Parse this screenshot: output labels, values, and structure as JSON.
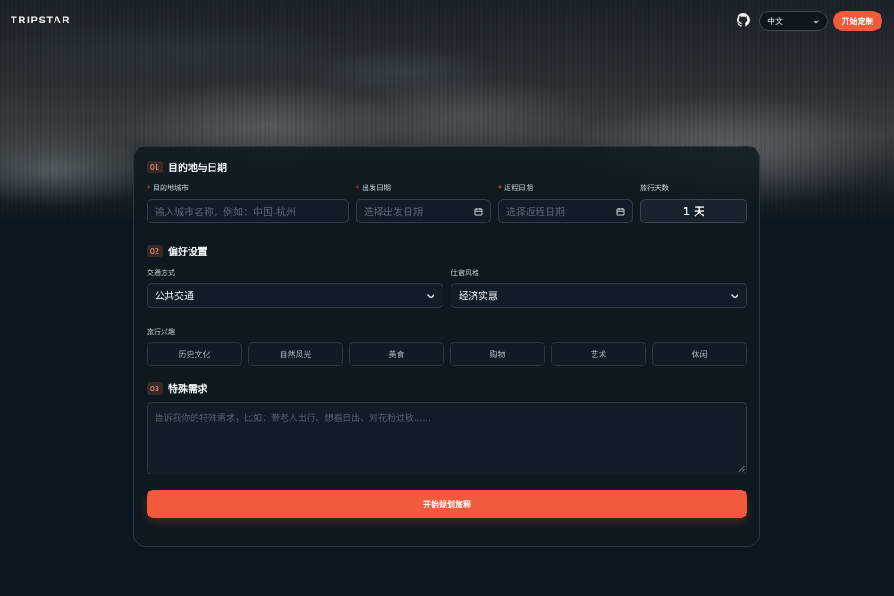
{
  "header": {
    "brand": "TRIPSTAR",
    "language": "中文",
    "cta_label": "开始定制",
    "icons": {
      "github": "github-icon",
      "lang_chevron": "chevron-down-icon"
    }
  },
  "sections": {
    "destination": {
      "number": "01",
      "title": "目的地与日期",
      "city_label": "目的地城市",
      "city_placeholder": "输入城市名称，例如：中国-杭州",
      "depart_label": "出发日期",
      "depart_placeholder": "选择出发日期",
      "return_label": "返程日期",
      "return_placeholder": "选择返程日期",
      "days_label": "旅行天数",
      "days_value": "1 天",
      "required_mark": "*"
    },
    "preferences": {
      "number": "02",
      "title": "偏好设置",
      "transport_label": "交通方式",
      "transport_value": "公共交通",
      "lodging_label": "住宿风格",
      "lodging_value": "经济实惠",
      "interests_label": "旅行兴趣",
      "interests": [
        "历史文化",
        "自然风光",
        "美食",
        "购物",
        "艺术",
        "休闲"
      ]
    },
    "special": {
      "number": "03",
      "title": "特殊需求",
      "placeholder": "告诉我你的特殊需求，比如：带老人出行、想看日出、对花粉过敏......"
    }
  },
  "submit_label": "开始规划旅程",
  "colors": {
    "accent": "#f25a3e",
    "background": "#0c161e",
    "card": "#0e1820"
  }
}
